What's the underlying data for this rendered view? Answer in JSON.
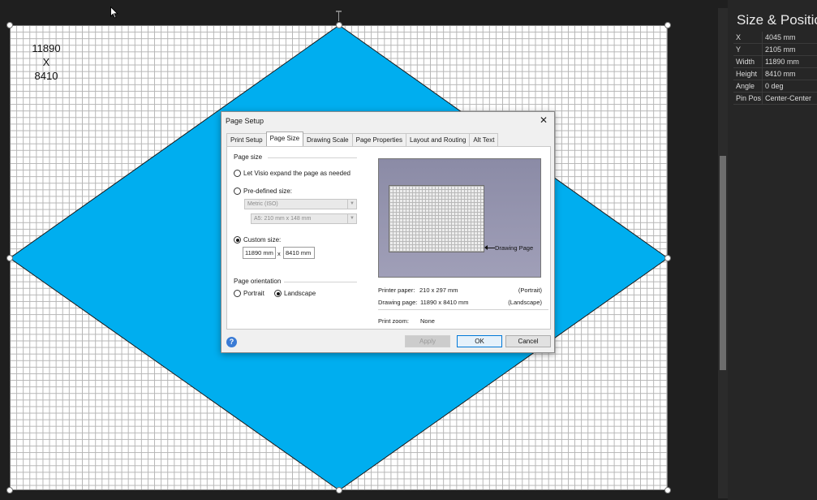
{
  "canvas": {
    "page_label_line1": "11890",
    "page_label_line2": "X",
    "page_label_line3": "8410",
    "shape_color": "#00aeef"
  },
  "side_panel": {
    "title": "Size & Position",
    "rows": [
      {
        "key": "X",
        "value": "4045 mm"
      },
      {
        "key": "Y",
        "value": "2105 mm"
      },
      {
        "key": "Width",
        "value": "11890 mm"
      },
      {
        "key": "Height",
        "value": "8410 mm"
      },
      {
        "key": "Angle",
        "value": "0 deg"
      },
      {
        "key": "Pin Pos",
        "value": "Center-Center"
      }
    ]
  },
  "dialog": {
    "title": "Page Setup",
    "close_icon": "close-icon",
    "tabs": [
      "Print Setup",
      "Page Size",
      "Drawing Scale",
      "Page Properties",
      "Layout and Routing",
      "Alt Text"
    ],
    "active_tab": "Page Size",
    "page_size_group": "Page size",
    "option_expand": "Let Visio expand the page as needed",
    "option_predefined": "Pre-defined size:",
    "predefined_standard": "Metric (ISO)",
    "predefined_size": "A5:  210 mm x 148 mm",
    "option_custom": "Custom size:",
    "custom_width": "11890 mm",
    "custom_x": "x",
    "custom_height": "8410 mm",
    "orientation_group": "Page orientation",
    "orientation_portrait": "Portrait",
    "orientation_landscape": "Landscape",
    "selected_size_option": "custom",
    "selected_orientation": "landscape",
    "preview_label": "Drawing Page",
    "printer_paper_label": "Printer paper:",
    "printer_paper_value": "210 x 297 mm",
    "printer_paper_orientation": "(Portrait)",
    "drawing_page_label": "Drawing page:",
    "drawing_page_value": "11890 x 8410 mm",
    "drawing_page_orientation": "(Landscape)",
    "print_zoom_label": "Print zoom:",
    "print_zoom_value": "None",
    "buttons": {
      "apply": "Apply",
      "ok": "OK",
      "cancel": "Cancel"
    },
    "help_icon": "?"
  }
}
